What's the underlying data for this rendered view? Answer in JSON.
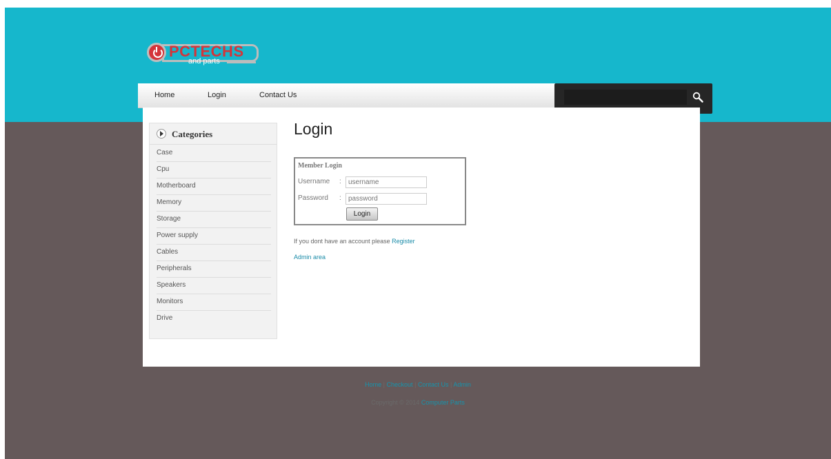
{
  "brand": {
    "logo_main": "PCTECHS",
    "logo_sub": "and parts",
    "colors": {
      "primary": "#16b7cc",
      "accent": "#d4353a",
      "background": "#65595a"
    }
  },
  "nav": {
    "items": [
      "Home",
      "Login",
      "Contact Us"
    ],
    "search_value": "",
    "search_icon": "magnifier-icon"
  },
  "sidebar": {
    "title": "Categories",
    "items": [
      "Case",
      "Cpu",
      "Motherboard",
      "Memory",
      "Storage",
      "Power supply",
      "Cables",
      "Peripherals",
      "Speakers",
      "Monitors",
      "Drive"
    ]
  },
  "main": {
    "title": "Login",
    "form": {
      "title": "Member Login",
      "username_label": "Username",
      "username_placeholder": "username",
      "password_label": "Password",
      "password_placeholder": "password",
      "separator": ":",
      "submit_label": "Login"
    },
    "register_text": "If you dont have an account please",
    "register_link": "Register",
    "admin_link": "Admin area"
  },
  "footer": {
    "links": [
      "Home",
      "Checkout",
      "Contact Us",
      "Admin"
    ],
    "separator": "|",
    "copyright_text": "Copyright © 2014",
    "copyright_link": "Computer Parts"
  }
}
